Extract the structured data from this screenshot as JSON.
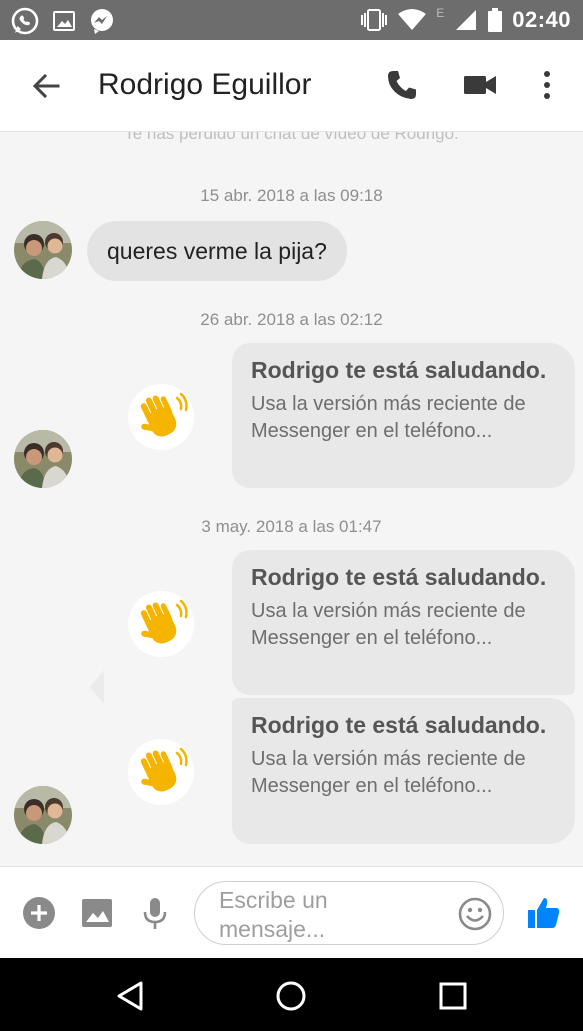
{
  "status_bar": {
    "time": "02:40",
    "network_label": "E",
    "icons": [
      "whatsapp-icon",
      "gallery-icon",
      "messenger-notification-icon",
      "vibrate-icon",
      "wifi-icon",
      "signal-icon",
      "battery-icon"
    ]
  },
  "header": {
    "title": "Rodrigo Eguillor",
    "icons": [
      "back-arrow-icon",
      "phone-icon",
      "video-camera-icon",
      "more-vert-icon"
    ]
  },
  "chat": {
    "missed_video": "Te has perdido un chat de vídeo de Rodrigo.",
    "sections": [
      {
        "timestamp": "15 abr. 2018 a las 09:18",
        "text_message": "queres verme la pija?"
      },
      {
        "timestamp": "26 abr. 2018 a las 02:12",
        "cards": [
          {
            "title": "Rodrigo te está saludando.",
            "body": "Usa la versión más reciente de Messenger en el teléfono..."
          }
        ]
      },
      {
        "timestamp": "3 may. 2018 a las 01:47",
        "cards": [
          {
            "title": "Rodrigo te está saludando.",
            "body": "Usa la versión más reciente de Messenger en el teléfono..."
          },
          {
            "title": "Rodrigo te está saludando.",
            "body": "Usa la versión más reciente de Messenger en el teléfono..."
          }
        ]
      }
    ]
  },
  "composer": {
    "placeholder": "Escribe un mensaje...",
    "icons": [
      "add-icon",
      "image-icon",
      "microphone-icon",
      "emoji-icon",
      "thumbs-up-icon"
    ]
  },
  "colors": {
    "accent": "#0084ff",
    "status_bar": "#6d6d6d",
    "bubble": "#e3e3e3",
    "card": "#e8e8e8",
    "wave": "#f4b400"
  }
}
